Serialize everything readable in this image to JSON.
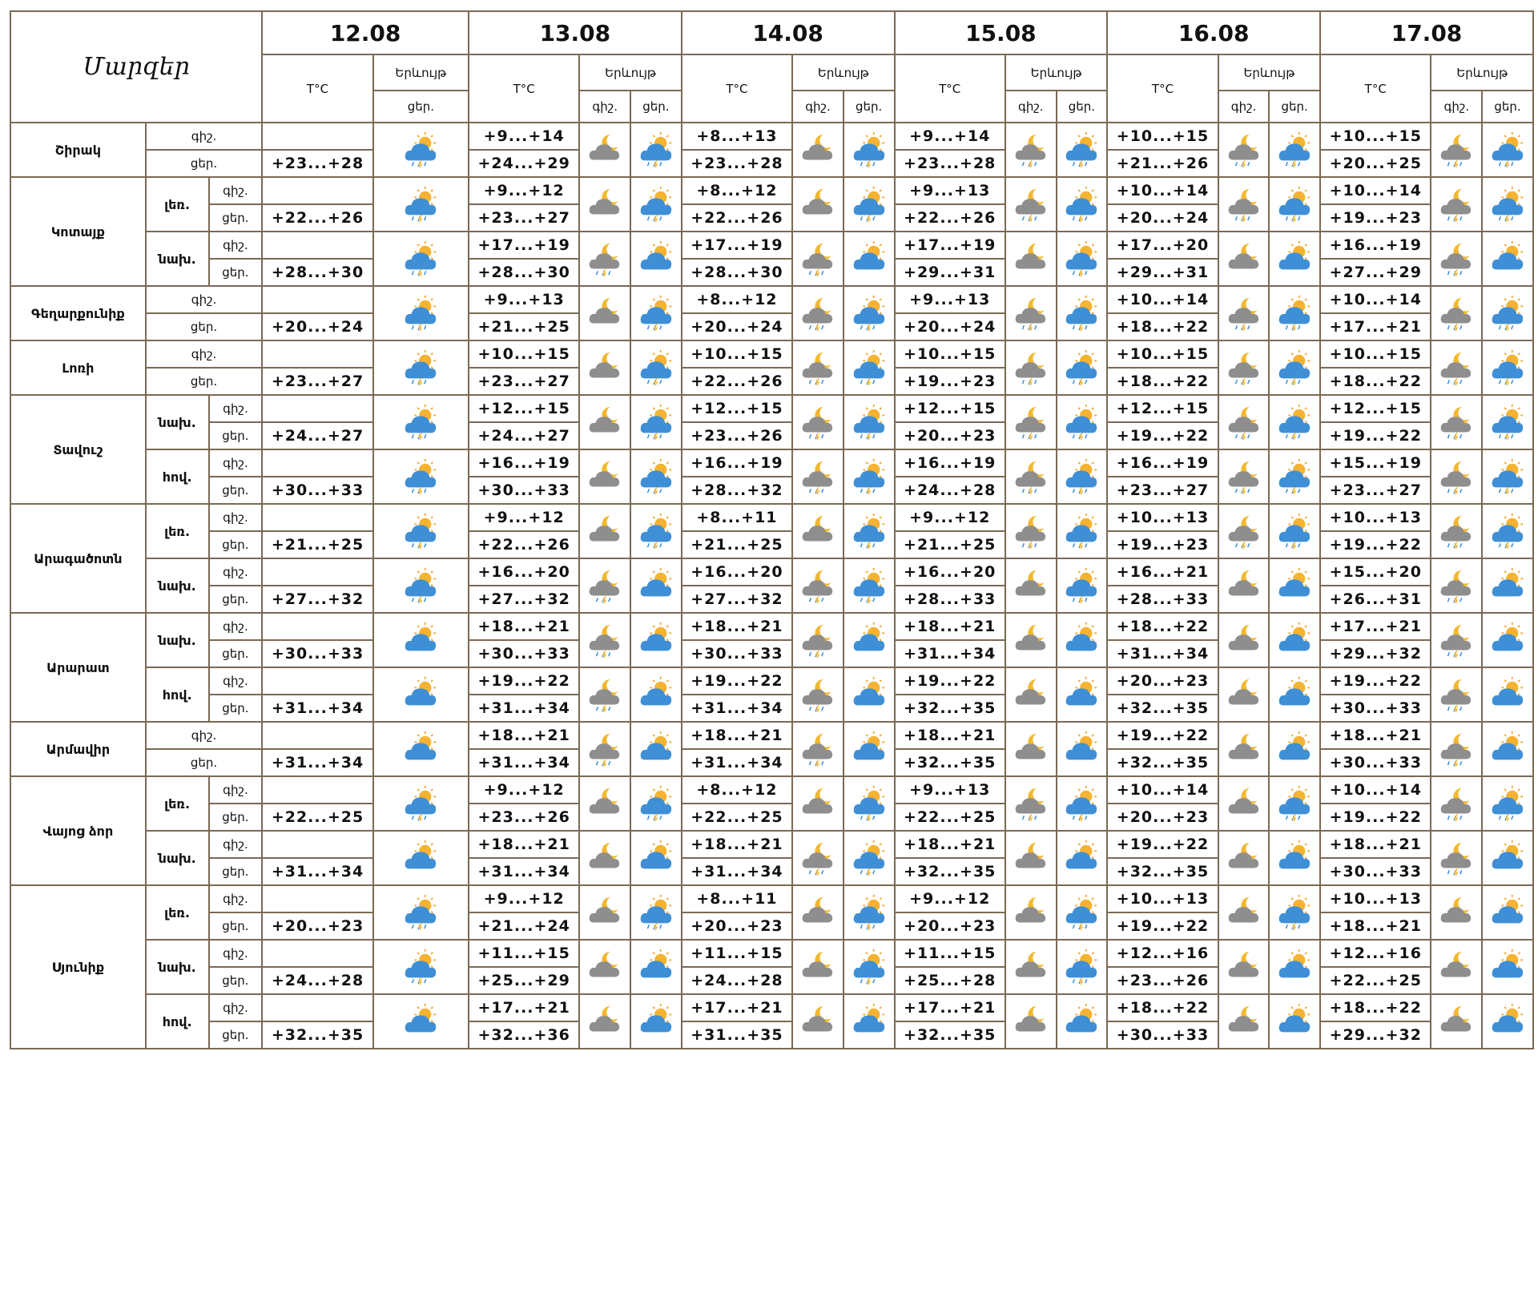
{
  "header": {
    "title": "Մարզեր",
    "temp_label": "T°C",
    "phenomenon_label": "Երևույթ",
    "night_label": "գիշ.",
    "day_label": "ցեր.",
    "dates": [
      "12.08",
      "13.08",
      "14.08",
      "15.08",
      "16.08",
      "17.08"
    ]
  },
  "icon_types": {
    "cn": "cloud-night",
    "cnr": "cloud-night-rain",
    "cdr": "cloud-sun-rain",
    "cds": "cloud-sun"
  },
  "regions": [
    {
      "name": "Շիրակ",
      "zones": [
        {
          "label": "",
          "night": [
            "+9...+14",
            "+8...+13",
            "+9...+14",
            "+10...+15",
            "+10...+15"
          ],
          "day": [
            "+23...+28",
            "+24...+29",
            "+23...+28",
            "+23...+28",
            "+21...+26",
            "+20...+25"
          ],
          "d0": "cdr",
          "icons": [
            [
              "cn",
              "cdr"
            ],
            [
              "cn",
              "cdr"
            ],
            [
              "cnr",
              "cdr"
            ],
            [
              "cnr",
              "cdr"
            ],
            [
              "cnr",
              "cdr"
            ]
          ]
        }
      ]
    },
    {
      "name": "Կոտայք",
      "zones": [
        {
          "label": "լեռ.",
          "night": [
            "+9...+12",
            "+8...+12",
            "+9...+13",
            "+10...+14",
            "+10...+14"
          ],
          "day": [
            "+22...+26",
            "+23...+27",
            "+22...+26",
            "+22...+26",
            "+20...+24",
            "+19...+23"
          ],
          "d0": "cdr",
          "icons": [
            [
              "cn",
              "cdr"
            ],
            [
              "cn",
              "cdr"
            ],
            [
              "cnr",
              "cdr"
            ],
            [
              "cnr",
              "cdr"
            ],
            [
              "cnr",
              "cdr"
            ]
          ]
        },
        {
          "label": "նախ.",
          "night": [
            "+17...+19",
            "+17...+19",
            "+17...+19",
            "+17...+20",
            "+16...+19"
          ],
          "day": [
            "+28...+30",
            "+28...+30",
            "+28...+30",
            "+29...+31",
            "+29...+31",
            "+27...+29"
          ],
          "d0": "cdr",
          "icons": [
            [
              "cnr",
              "cds"
            ],
            [
              "cnr",
              "cds"
            ],
            [
              "cn",
              "cdr"
            ],
            [
              "cn",
              "cds"
            ],
            [
              "cnr",
              "cds"
            ]
          ]
        }
      ]
    },
    {
      "name": "Գեղարքունիք",
      "zones": [
        {
          "label": "",
          "night": [
            "+9...+13",
            "+8...+12",
            "+9...+13",
            "+10...+14",
            "+10...+14"
          ],
          "day": [
            "+20...+24",
            "+21...+25",
            "+20...+24",
            "+20...+24",
            "+18...+22",
            "+17...+21"
          ],
          "d0": "cdr",
          "icons": [
            [
              "cn",
              "cdr"
            ],
            [
              "cnr",
              "cdr"
            ],
            [
              "cnr",
              "cdr"
            ],
            [
              "cnr",
              "cdr"
            ],
            [
              "cnr",
              "cdr"
            ]
          ]
        }
      ]
    },
    {
      "name": "Լոռի",
      "zones": [
        {
          "label": "",
          "night": [
            "+10...+15",
            "+10...+15",
            "+10...+15",
            "+10...+15",
            "+10...+15"
          ],
          "day": [
            "+23...+27",
            "+23...+27",
            "+22...+26",
            "+19...+23",
            "+18...+22",
            "+18...+22"
          ],
          "d0": "cdr",
          "icons": [
            [
              "cn",
              "cdr"
            ],
            [
              "cnr",
              "cdr"
            ],
            [
              "cnr",
              "cdr"
            ],
            [
              "cnr",
              "cdr"
            ],
            [
              "cnr",
              "cdr"
            ]
          ]
        }
      ]
    },
    {
      "name": "Տավուշ",
      "zones": [
        {
          "label": "նախ.",
          "night": [
            "+12...+15",
            "+12...+15",
            "+12...+15",
            "+12...+15",
            "+12...+15"
          ],
          "day": [
            "+24...+27",
            "+24...+27",
            "+23...+26",
            "+20...+23",
            "+19...+22",
            "+19...+22"
          ],
          "d0": "cdr",
          "icons": [
            [
              "cn",
              "cdr"
            ],
            [
              "cnr",
              "cdr"
            ],
            [
              "cnr",
              "cdr"
            ],
            [
              "cnr",
              "cdr"
            ],
            [
              "cnr",
              "cdr"
            ]
          ]
        },
        {
          "label": "հով.",
          "night": [
            "+16...+19",
            "+16...+19",
            "+16...+19",
            "+16...+19",
            "+15...+19"
          ],
          "day": [
            "+30...+33",
            "+30...+33",
            "+28...+32",
            "+24...+28",
            "+23...+27",
            "+23...+27"
          ],
          "d0": "cdr",
          "icons": [
            [
              "cn",
              "cdr"
            ],
            [
              "cnr",
              "cdr"
            ],
            [
              "cnr",
              "cdr"
            ],
            [
              "cnr",
              "cdr"
            ],
            [
              "cnr",
              "cdr"
            ]
          ]
        }
      ]
    },
    {
      "name": "Արագածոտն",
      "zones": [
        {
          "label": "լեռ.",
          "night": [
            "+9...+12",
            "+8...+11",
            "+9...+12",
            "+10...+13",
            "+10...+13"
          ],
          "day": [
            "+21...+25",
            "+22...+26",
            "+21...+25",
            "+21...+25",
            "+19...+23",
            "+19...+22"
          ],
          "d0": "cdr",
          "icons": [
            [
              "cn",
              "cdr"
            ],
            [
              "cn",
              "cdr"
            ],
            [
              "cnr",
              "cdr"
            ],
            [
              "cnr",
              "cdr"
            ],
            [
              "cnr",
              "cdr"
            ]
          ]
        },
        {
          "label": "նախ.",
          "night": [
            "+16...+20",
            "+16...+20",
            "+16...+20",
            "+16...+21",
            "+15...+20"
          ],
          "day": [
            "+27...+32",
            "+27...+32",
            "+27...+32",
            "+28...+33",
            "+28...+33",
            "+26...+31"
          ],
          "d0": "cdr",
          "icons": [
            [
              "cnr",
              "cds"
            ],
            [
              "cnr",
              "cdr"
            ],
            [
              "cn",
              "cdr"
            ],
            [
              "cn",
              "cds"
            ],
            [
              "cnr",
              "cds"
            ]
          ]
        }
      ]
    },
    {
      "name": "Արարատ",
      "zones": [
        {
          "label": "նախ.",
          "night": [
            "+18...+21",
            "+18...+21",
            "+18...+21",
            "+18...+22",
            "+17...+21"
          ],
          "day": [
            "+30...+33",
            "+30...+33",
            "+30...+33",
            "+31...+34",
            "+31...+34",
            "+29...+32"
          ],
          "d0": "cds",
          "icons": [
            [
              "cnr",
              "cds"
            ],
            [
              "cnr",
              "cds"
            ],
            [
              "cn",
              "cds"
            ],
            [
              "cn",
              "cds"
            ],
            [
              "cnr",
              "cds"
            ]
          ]
        },
        {
          "label": "հով.",
          "night": [
            "+19...+22",
            "+19...+22",
            "+19...+22",
            "+20...+23",
            "+19...+22"
          ],
          "day": [
            "+31...+34",
            "+31...+34",
            "+31...+34",
            "+32...+35",
            "+32...+35",
            "+30...+33"
          ],
          "d0": "cds",
          "icons": [
            [
              "cnr",
              "cds"
            ],
            [
              "cnr",
              "cds"
            ],
            [
              "cn",
              "cds"
            ],
            [
              "cn",
              "cds"
            ],
            [
              "cnr",
              "cds"
            ]
          ]
        }
      ]
    },
    {
      "name": "Արմավիր",
      "zones": [
        {
          "label": "",
          "night": [
            "+18...+21",
            "+18...+21",
            "+18...+21",
            "+19...+22",
            "+18...+21"
          ],
          "day": [
            "+31...+34",
            "+31...+34",
            "+31...+34",
            "+32...+35",
            "+32...+35",
            "+30...+33"
          ],
          "d0": "cds",
          "icons": [
            [
              "cnr",
              "cds"
            ],
            [
              "cnr",
              "cds"
            ],
            [
              "cn",
              "cds"
            ],
            [
              "cn",
              "cds"
            ],
            [
              "cnr",
              "cds"
            ]
          ]
        }
      ]
    },
    {
      "name": "Վայոց ձոր",
      "zones": [
        {
          "label": "լեռ.",
          "night": [
            "+9...+12",
            "+8...+12",
            "+9...+13",
            "+10...+14",
            "+10...+14"
          ],
          "day": [
            "+22...+25",
            "+23...+26",
            "+22...+25",
            "+22...+25",
            "+20...+23",
            "+19...+22"
          ],
          "d0": "cdr",
          "icons": [
            [
              "cn",
              "cdr"
            ],
            [
              "cn",
              "cdr"
            ],
            [
              "cnr",
              "cdr"
            ],
            [
              "cn",
              "cdr"
            ],
            [
              "cnr",
              "cdr"
            ]
          ]
        },
        {
          "label": "նախ.",
          "night": [
            "+18...+21",
            "+18...+21",
            "+18...+21",
            "+19...+22",
            "+18...+21"
          ],
          "day": [
            "+31...+34",
            "+31...+34",
            "+31...+34",
            "+32...+35",
            "+32...+35",
            "+30...+33"
          ],
          "d0": "cds",
          "icons": [
            [
              "cn",
              "cds"
            ],
            [
              "cnr",
              "cdr"
            ],
            [
              "cn",
              "cds"
            ],
            [
              "cn",
              "cds"
            ],
            [
              "cnr",
              "cds"
            ]
          ]
        }
      ]
    },
    {
      "name": "Սյունիք",
      "zones": [
        {
          "label": "լեռ.",
          "night": [
            "+9...+12",
            "+8...+11",
            "+9...+12",
            "+10...+13",
            "+10...+13"
          ],
          "day": [
            "+20...+23",
            "+21...+24",
            "+20...+23",
            "+20...+23",
            "+19...+22",
            "+18...+21"
          ],
          "d0": "cdr",
          "icons": [
            [
              "cn",
              "cdr"
            ],
            [
              "cn",
              "cdr"
            ],
            [
              "cn",
              "cdr"
            ],
            [
              "cn",
              "cdr"
            ],
            [
              "cn",
              "cds"
            ]
          ]
        },
        {
          "label": "նախ.",
          "night": [
            "+11...+15",
            "+11...+15",
            "+11...+15",
            "+12...+16",
            "+12...+16"
          ],
          "day": [
            "+24...+28",
            "+25...+29",
            "+24...+28",
            "+25...+28",
            "+23...+26",
            "+22...+25"
          ],
          "d0": "cdr",
          "icons": [
            [
              "cn",
              "cds"
            ],
            [
              "cn",
              "cdr"
            ],
            [
              "cn",
              "cdr"
            ],
            [
              "cn",
              "cds"
            ],
            [
              "cn",
              "cds"
            ]
          ]
        },
        {
          "label": "հով.",
          "night": [
            "+17...+21",
            "+17...+21",
            "+17...+21",
            "+18...+22",
            "+18...+22"
          ],
          "day": [
            "+32...+35",
            "+32...+36",
            "+31...+35",
            "+32...+35",
            "+30...+33",
            "+29...+32"
          ],
          "d0": "cds",
          "icons": [
            [
              "cn",
              "cds"
            ],
            [
              "cn",
              "cds"
            ],
            [
              "cn",
              "cds"
            ],
            [
              "cn",
              "cds"
            ],
            [
              "cn",
              "cds"
            ]
          ]
        }
      ]
    }
  ]
}
